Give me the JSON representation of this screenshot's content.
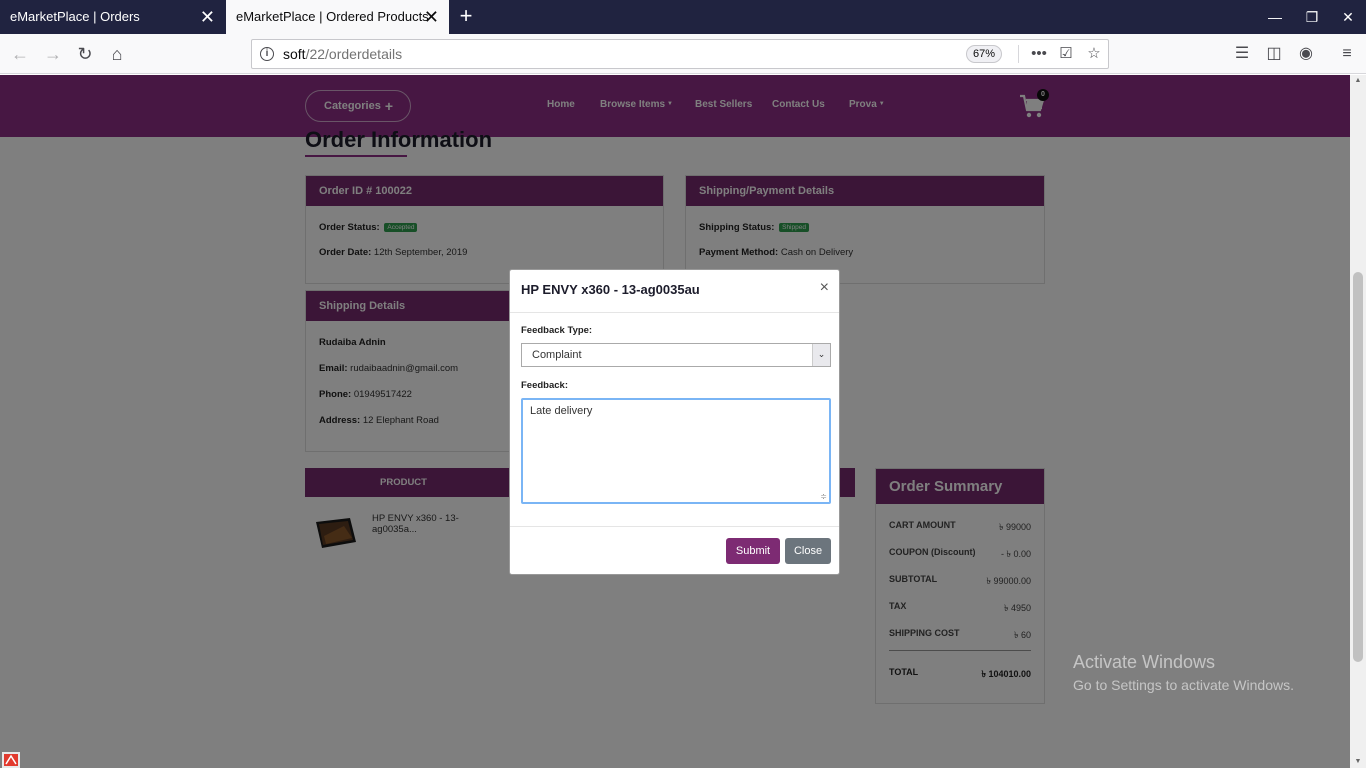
{
  "browser": {
    "tabs": [
      {
        "title": "eMarketPlace | Orders",
        "active": false
      },
      {
        "title": "eMarketPlace | Ordered Products",
        "active": true
      }
    ],
    "url_host": "soft",
    "url_path": "/22/orderdetails",
    "zoom": "67%"
  },
  "header": {
    "categories_label": "Categories",
    "menu": [
      "Home",
      "Browse Items",
      "Best Sellers",
      "Contact Us",
      "Prova"
    ],
    "cart_count": "0"
  },
  "page_title": "Order Information",
  "order_card": {
    "title": "Order ID # 100022",
    "status_label": "Order Status:",
    "status_value": "Accepted",
    "date_label": "Order Date:",
    "date_value": "12th September, 2019"
  },
  "shipping_payment_card": {
    "title": "Shipping/Payment Details",
    "shipping_status_label": "Shipping Status:",
    "shipping_status_value": "Shipped",
    "payment_label": "Payment Method:",
    "payment_value": "Cash on Delivery"
  },
  "shipping_details_card": {
    "title": "Shipping Details",
    "name": "Rudaiba Adnin",
    "email_label": "Email:",
    "email_value": "rudaibaadnin@gmail.com",
    "phone_label": "Phone:",
    "phone_value": "01949517422",
    "address_label": "Address:",
    "address_value": "12 Elephant Road"
  },
  "products": {
    "column_header": "PRODUCT",
    "items": [
      {
        "name": "HP ENVY x360 - 13-ag0035a..."
      }
    ]
  },
  "summary": {
    "title": "Order Summary",
    "rows": [
      {
        "label": "CART AMOUNT",
        "value": "৳ 99000"
      },
      {
        "label": "COUPON (Discount)",
        "value": "- ৳ 0.00"
      },
      {
        "label": "SUBTOTAL",
        "value": "৳ 99000.00"
      },
      {
        "label": "TAX",
        "value": "৳ 4950"
      },
      {
        "label": "SHIPPING COST",
        "value": "৳ 60"
      }
    ],
    "total_label": "TOTAL",
    "total_value": "৳ 104010.00"
  },
  "modal": {
    "title": "HP ENVY x360 - 13-ag0035au",
    "close_glyph": "×",
    "feedback_type_label": "Feedback Type:",
    "feedback_type_value": "Complaint",
    "feedback_label": "Feedback:",
    "feedback_value": "Late delivery",
    "submit_label": "Submit",
    "close_label": "Close"
  },
  "watermark": {
    "line1": "Activate Windows",
    "line2": "Go to Settings to activate Windows."
  },
  "colors": {
    "brand": "#8e2f86",
    "card_header": "#772a6e",
    "status_green": "#2e9e4f"
  }
}
